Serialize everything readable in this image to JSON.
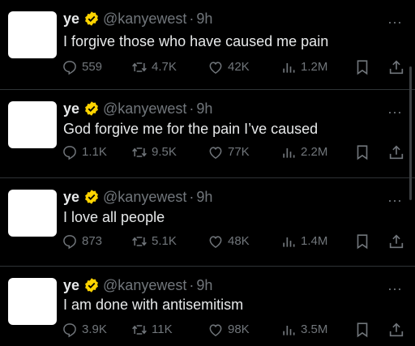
{
  "tweets": [
    {
      "name": "ye",
      "handle": "@kanyewest",
      "dot": "·",
      "time": "9h",
      "more": "···",
      "text": "I forgive those who have caused me pain",
      "replies": "559",
      "retweets": "4.7K",
      "likes": "42K",
      "views": "1.2M"
    },
    {
      "name": "ye",
      "handle": "@kanyewest",
      "dot": "·",
      "time": "9h",
      "more": "···",
      "text": "God forgive me for the pain I’ve caused",
      "replies": "1.1K",
      "retweets": "9.5K",
      "likes": "77K",
      "views": "2.2M"
    },
    {
      "name": "ye",
      "handle": "@kanyewest",
      "dot": "·",
      "time": "9h",
      "more": "···",
      "text": "I love all people",
      "replies": "873",
      "retweets": "5.1K",
      "likes": "48K",
      "views": "1.4M"
    },
    {
      "name": "ye",
      "handle": "@kanyewest",
      "dot": "·",
      "time": "9h",
      "more": "···",
      "text": "I am done with antisemitism",
      "replies": "3.9K",
      "retweets": "11K",
      "likes": "98K",
      "views": "3.5M"
    }
  ],
  "colors": {
    "background": "#000000",
    "text": "#e7e9ea",
    "muted": "#71767b",
    "badge": "#ffd400",
    "divider": "#2f3336"
  },
  "icons": [
    "verified-badge-icon",
    "reply-icon",
    "retweet-icon",
    "like-icon",
    "views-icon",
    "bookmark-icon",
    "share-icon",
    "more-icon"
  ]
}
